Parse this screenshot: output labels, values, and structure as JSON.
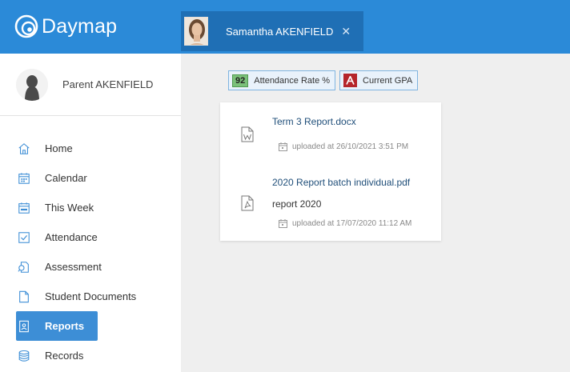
{
  "app": {
    "name": "Daymap",
    "brand_color": "#2b8ad8",
    "accent_color": "#3d8ed6"
  },
  "student_tab": {
    "name": "Samantha AKENFIELD",
    "close_symbol": "✕"
  },
  "parent": {
    "name": "Parent AKENFIELD"
  },
  "nav": {
    "items": [
      {
        "label": "Home",
        "icon": "home-icon"
      },
      {
        "label": "Calendar",
        "icon": "calendar-icon"
      },
      {
        "label": "This Week",
        "icon": "this-week-icon"
      },
      {
        "label": "Attendance",
        "icon": "attendance-check-icon"
      },
      {
        "label": "Assessment",
        "icon": "assessment-icon"
      },
      {
        "label": "Student Documents",
        "icon": "document-icon"
      },
      {
        "label": "Reports",
        "icon": "report-icon",
        "active": true
      },
      {
        "label": "Records",
        "icon": "database-icon"
      }
    ]
  },
  "badges": {
    "attendance": {
      "value": "92",
      "label": "Attendance Rate %"
    },
    "gpa": {
      "letter": "A",
      "label": "Current GPA"
    }
  },
  "documents": [
    {
      "title": "Term 3 Report.docx",
      "description": "",
      "uploaded": "uploaded at 26/10/2021 3:51 PM",
      "icon": "word-file-icon"
    },
    {
      "title": "2020 Report batch individual.pdf",
      "description": "report 2020",
      "uploaded": "uploaded at 17/07/2020 11:12 AM",
      "icon": "pdf-file-icon"
    }
  ]
}
